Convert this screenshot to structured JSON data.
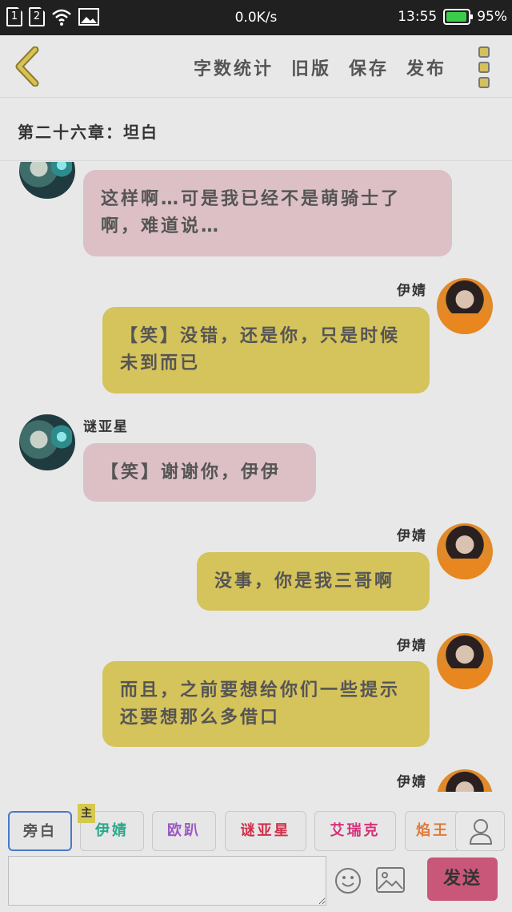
{
  "status_bar": {
    "sim1": "1",
    "sim2": "2",
    "network_speed": "0.0K/s",
    "time": "13:55",
    "battery_percent": "95%",
    "battery_level": 0.95,
    "battery_color": "#3ccb4b"
  },
  "toolbar": {
    "actions": [
      "字数统计",
      "旧版",
      "保存",
      "发布"
    ]
  },
  "chapter": {
    "title": "第二十六章：坦白"
  },
  "messages": [
    {
      "sender": "",
      "side": "left",
      "text": "这样啊…可是我已经不是萌骑士了啊，难道说…"
    },
    {
      "sender": "伊婧",
      "side": "right",
      "text": "【笑】没错，还是你，只是时候未到而已"
    },
    {
      "sender": "谜亚星",
      "side": "left",
      "text": "【笑】谢谢你，伊伊"
    },
    {
      "sender": "伊婧",
      "side": "right",
      "text": "没事，你是我三哥啊"
    },
    {
      "sender": "伊婧",
      "side": "right",
      "text": "而且，之前要想给你们一些提示还要想那么多借口"
    },
    {
      "sender": "伊婧",
      "side": "right",
      "text": ""
    }
  ],
  "characters": [
    {
      "label": "旁白",
      "color": "#555555",
      "selected": true,
      "main": false
    },
    {
      "label": "伊婧",
      "color": "#2aa88a",
      "selected": false,
      "main": true
    },
    {
      "label": "欧趴",
      "color": "#9b59c4",
      "selected": false,
      "main": false
    },
    {
      "label": "谜亚星",
      "color": "#d0304a",
      "selected": false,
      "main": false
    },
    {
      "label": "艾瑞克",
      "color": "#d6307a",
      "selected": false,
      "main": false
    },
    {
      "label": "焰王",
      "color": "#e07a3a",
      "selected": false,
      "main": false
    }
  ],
  "main_tag": "主",
  "composer": {
    "input_value": "",
    "send_label": "发送"
  },
  "icons": {
    "back": "chevron-left-icon",
    "menu": "menu-icon",
    "person": "person-icon",
    "emoji": "emoji-icon",
    "image": "image-icon",
    "wifi": "wifi-icon",
    "gallery": "gallery-icon"
  },
  "colors": {
    "accent_yellow": "#d5c35c",
    "bubble_pink": "#dcc0c6",
    "send_button": "#c8577a"
  }
}
